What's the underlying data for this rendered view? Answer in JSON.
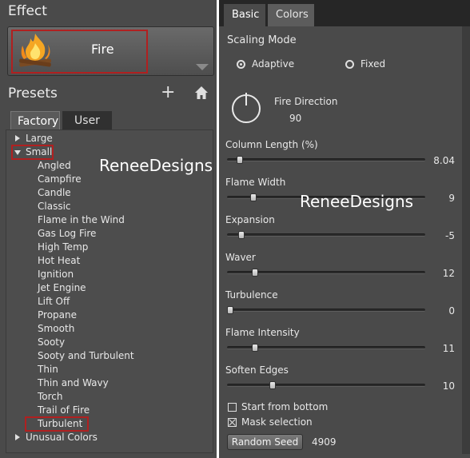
{
  "effect": {
    "title": "Effect",
    "name": "Fire"
  },
  "presets": {
    "title": "Presets",
    "add": "+",
    "tabs": [
      "Factory",
      "User"
    ],
    "tree": [
      {
        "label": "Large",
        "level": 0,
        "expander": "collapsed"
      },
      {
        "label": "Small",
        "level": 0,
        "expander": "expanded"
      },
      {
        "label": "Angled",
        "level": 1
      },
      {
        "label": "Campfire",
        "level": 1
      },
      {
        "label": "Candle",
        "level": 1
      },
      {
        "label": "Classic",
        "level": 1
      },
      {
        "label": "Flame in the Wind",
        "level": 1
      },
      {
        "label": "Gas Log Fire",
        "level": 1
      },
      {
        "label": "High Temp",
        "level": 1
      },
      {
        "label": "Hot Heat",
        "level": 1
      },
      {
        "label": "Ignition",
        "level": 1
      },
      {
        "label": "Jet Engine",
        "level": 1
      },
      {
        "label": "Lift Off",
        "level": 1
      },
      {
        "label": "Propane",
        "level": 1
      },
      {
        "label": "Smooth",
        "level": 1
      },
      {
        "label": "Sooty",
        "level": 1
      },
      {
        "label": "Sooty and Turbulent",
        "level": 1
      },
      {
        "label": "Thin",
        "level": 1
      },
      {
        "label": "Thin and Wavy",
        "level": 1
      },
      {
        "label": "Torch",
        "level": 1
      },
      {
        "label": "Trail of Fire",
        "level": 1
      },
      {
        "label": "Turbulent",
        "level": 1
      },
      {
        "label": "Unusual Colors",
        "level": 0,
        "expander": "collapsed"
      }
    ]
  },
  "watermark": "ReneeDesigns",
  "settings": {
    "tabs": [
      "Basic",
      "Colors"
    ],
    "scaling_mode": {
      "label": "Scaling Mode",
      "options": [
        "Adaptive",
        "Fixed"
      ],
      "selected": "Adaptive"
    },
    "fire_direction": {
      "label": "Fire Direction",
      "value": "90"
    },
    "sliders": [
      {
        "label": "Column Length (%)",
        "value": "8.04",
        "position": 0.05
      },
      {
        "label": "Flame Width",
        "value": "9",
        "position": 0.12
      },
      {
        "label": "Expansion",
        "value": "-5",
        "position": 0.06
      },
      {
        "label": "Waver",
        "value": "12",
        "position": 0.13
      },
      {
        "label": "Turbulence",
        "value": "0",
        "position": 0.0
      },
      {
        "label": "Flame Intensity",
        "value": "11",
        "position": 0.13
      },
      {
        "label": "Soften Edges",
        "value": "10",
        "position": 0.22
      }
    ],
    "start_from_bottom": {
      "label": "Start from bottom",
      "checked": false
    },
    "mask_selection": {
      "label": "Mask selection",
      "checked": true
    },
    "random_seed": {
      "label": "Random Seed",
      "value": "4909"
    }
  },
  "colors": {
    "highlight": "#b02020",
    "panel": "#4a4a4a"
  }
}
